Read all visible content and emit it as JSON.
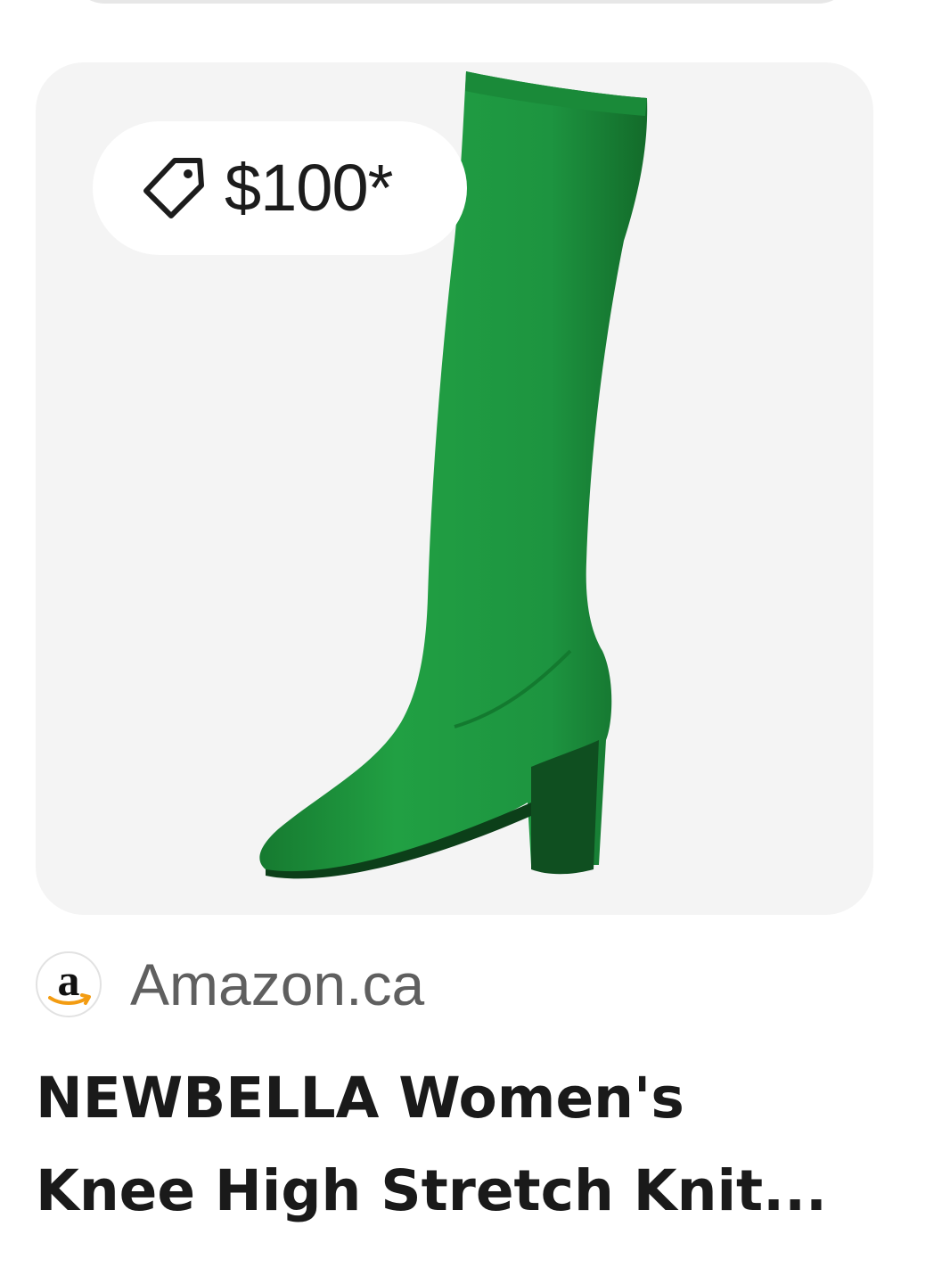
{
  "card": {
    "price": "$100*",
    "image_icon": "green-knee-high-boot",
    "tag_icon": "price-tag-icon"
  },
  "source": {
    "logo_letter": "a",
    "logo_icon": "amazon-logo",
    "name": "Amazon.ca"
  },
  "product": {
    "title_line1": "NEWBELLA Women's",
    "title_line2": "Knee High Stretch Knit..."
  },
  "colors": {
    "card_background": "#f4f4f4",
    "boot_green": "#1f9a3e",
    "text_primary": "#1a1a1a",
    "text_secondary": "#5f5f5f",
    "amazon_orange": "#f39c12"
  }
}
